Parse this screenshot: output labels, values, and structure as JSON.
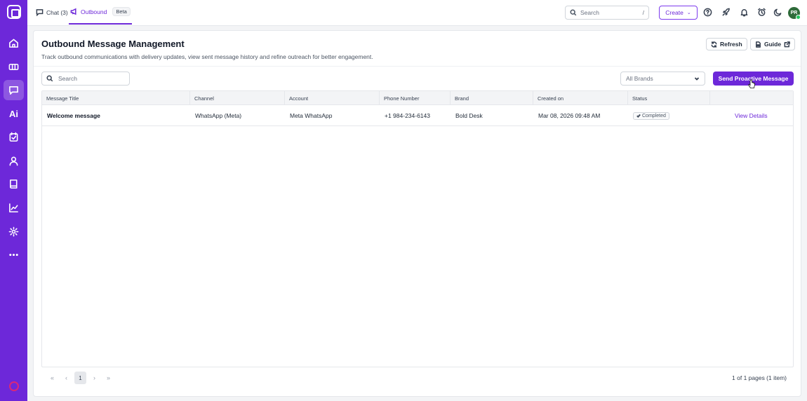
{
  "sidebar": {
    "items": [
      {
        "icon": "home-icon"
      },
      {
        "icon": "ticket-icon"
      },
      {
        "icon": "chat-icon",
        "active": true
      },
      {
        "icon": "ai-icon",
        "label": "Ai"
      },
      {
        "icon": "task-icon"
      },
      {
        "icon": "contact-icon"
      },
      {
        "icon": "knowledge-base-icon"
      },
      {
        "icon": "reports-icon"
      },
      {
        "icon": "settings-icon"
      },
      {
        "icon": "more-icon"
      }
    ]
  },
  "topbar": {
    "tabs": [
      {
        "label": "Chat (3)",
        "icon": "chat-icon"
      },
      {
        "label": "Outbound",
        "icon": "megaphone-icon",
        "badge": "Beta"
      }
    ],
    "search": {
      "placeholder": "Search",
      "shortcut": "/"
    },
    "create_label": "Create",
    "avatar_initials": "PR"
  },
  "page": {
    "title": "Outbound Message Management",
    "description": "Track outbound communications with delivery updates, view sent message history and refine outreach for better engagement.",
    "refresh_label": "Refresh",
    "guide_label": "Guide",
    "search_placeholder": "Search",
    "brand_filter": "All Brands",
    "send_button": "Send Proactive Message"
  },
  "table": {
    "columns": [
      "Message Title",
      "Channel",
      "Account",
      "Phone Number",
      "Brand",
      "Created on",
      "Status",
      ""
    ],
    "rows": [
      {
        "title": "Welcome message",
        "channel": "WhatsApp (Meta)",
        "account": "Meta WhatsApp",
        "phone": "+1 984-234-6143",
        "brand": "Bold Desk",
        "created_on": "Mar 08, 2026 09:48 AM",
        "status": "Completed",
        "action": "View Details"
      }
    ]
  },
  "pagination": {
    "current_page": "1",
    "info": "1 of 1 pages (1 item)"
  },
  "colors": {
    "accent": "#6d28d9",
    "sidebar": "#6d28d9"
  }
}
